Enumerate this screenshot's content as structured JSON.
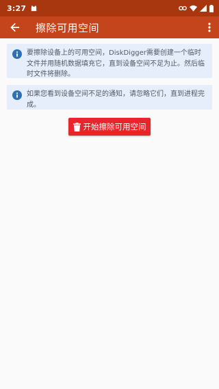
{
  "status_bar": {
    "time": "3:27",
    "icons": [
      "app-notification-icon",
      "link-icon",
      "wifi-icon",
      "signal-icon",
      "battery-icon"
    ]
  },
  "app_bar": {
    "title": "擦除可用空间",
    "back_icon": "arrow-left-icon",
    "menu_icon": "more-vert-icon"
  },
  "info_cards": [
    {
      "icon": "info-icon",
      "text": "要擦除设备上的可用空间，DiskDigger需要创建一个临时文件并用随机数据填充它，直到设备空间不足为止。然后临时文件将删除。"
    },
    {
      "icon": "info-icon",
      "text": "如果您看到设备空间不足的通知，请忽略它们，直到进程完成。"
    }
  ],
  "action": {
    "label": "开始擦除可用空间",
    "icon": "trash-icon"
  },
  "colors": {
    "status_bar": "#a8370f",
    "app_bar": "#c4441b",
    "card_bg": "#e6eefb",
    "info_icon": "#2f6fb3",
    "button": "#e8252b"
  }
}
